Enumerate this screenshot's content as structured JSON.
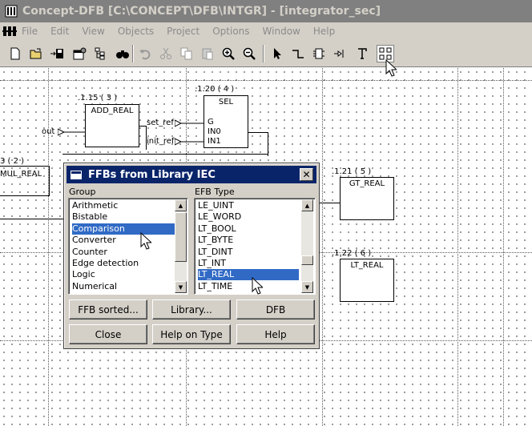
{
  "window": {
    "title": "Concept-DFB [C:\\CONCEPT\\DFB\\INTGR] - [integrator_sec]"
  },
  "menu": [
    "File",
    "Edit",
    "View",
    "Objects",
    "Project",
    "Options",
    "Window",
    "Help"
  ],
  "toolbar": {
    "buttons": [
      "new-icon",
      "open-icon",
      "save-icon",
      "properties-icon",
      "tree-icon",
      "find-icon",
      "undo-icon",
      "cut-icon",
      "copy-icon",
      "paste-icon",
      "zoom-in-icon",
      "zoom-out-icon",
      "select-mode-icon",
      "link-mode-icon",
      "ffb-mode-icon",
      "io-mode-icon",
      "text-mode-icon",
      "ffb-library-icon"
    ],
    "selected": "ffb-library-icon"
  },
  "diagram": {
    "blocks": [
      {
        "ref": ".1.15 ( 3 )",
        "name": "ADD_REAL"
      },
      {
        "ref": ".1.20 ( 4 )",
        "name": "SEL",
        "pins": [
          "G",
          "IN0",
          "IN1"
        ]
      },
      {
        "ref": ".1.21 ( 5 )",
        "name": "GT_REAL"
      },
      {
        "ref": ".1.22 ( 6 )",
        "name": "LT_REAL"
      },
      {
        "ref": "3 ( 2 )",
        "name": "MUL_REAL"
      }
    ],
    "variables": [
      "out",
      "set_ref",
      "init_ref"
    ]
  },
  "dialog": {
    "title": "FFBs from Library IEC",
    "close_glyph": "✕",
    "group_label": "Group",
    "type_label": "EFB Type",
    "groups": [
      "Arithmetic",
      "Bistable",
      "Comparison",
      "Converter",
      "Counter",
      "Edge detection",
      "Logic",
      "Numerical"
    ],
    "groups_selected": "Comparison",
    "types": [
      "LE_UINT",
      "LE_WORD",
      "LT_BOOL",
      "LT_BYTE",
      "LT_DINT",
      "LT_INT",
      "LT_REAL",
      "LT_TIME"
    ],
    "types_selected": "LT_REAL",
    "buttons": {
      "ffb_sorted": "FFB sorted...",
      "library": "Library...",
      "dfb": "DFB",
      "close": "Close",
      "help_on_type": "Help on Type",
      "help": "Help"
    }
  },
  "colors": {
    "titlebar_inactive": "#808080",
    "dialog_titlebar": "#0a246a",
    "selection": "#316ac5",
    "chrome": "#d4d0c8"
  }
}
